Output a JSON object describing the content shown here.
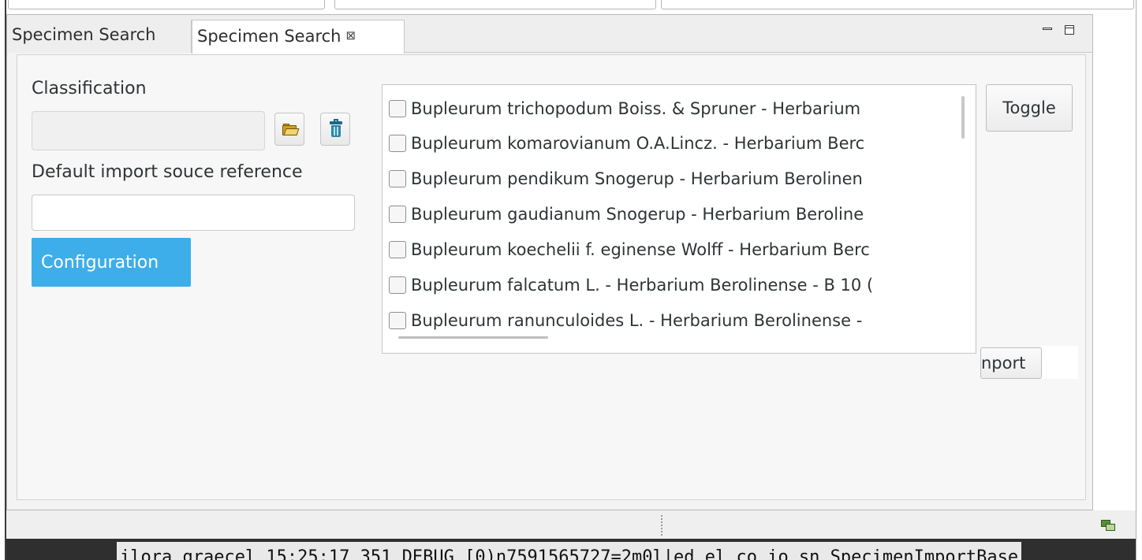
{
  "tabs": [
    {
      "label": "Specimen Search",
      "active": false
    },
    {
      "label": "Specimen Search",
      "active": true
    }
  ],
  "tab_close_glyph": "⊠",
  "view_controls": {
    "minimize": "minimize-icon",
    "maximize": "maximize-icon"
  },
  "form": {
    "classification_label": "Classification",
    "classification_value": "",
    "default_import_label": "Default import souce reference",
    "default_import_value": "",
    "configuration_button": "Configuration"
  },
  "results": [
    "Bupleurum trichopodum Boiss. & Spruner - Herbarium",
    "Bupleurum komarovianum O.A.Lincz. - Herbarium Berc",
    "Bupleurum pendikum Snogerup - Herbarium Berolinen",
    "Bupleurum gaudianum Snogerup - Herbarium Beroline",
    "Bupleurum koechelii f. eginense Wolff - Herbarium Berc",
    "Bupleurum falcatum L. - Herbarium Berolinense - B 10 (",
    "Bupleurum ranunculoides L. - Herbarium Berolinense -"
  ],
  "toggle_button": "Toggle",
  "import_button": "nport",
  "console_text": "ilora graecel 15:25:17 351 DEBUG [0)n7591565727=2m0l|ed el co io sn SpecimenImportBase",
  "colors": {
    "accent": "#3daee9",
    "background": "#f7f7f7"
  }
}
